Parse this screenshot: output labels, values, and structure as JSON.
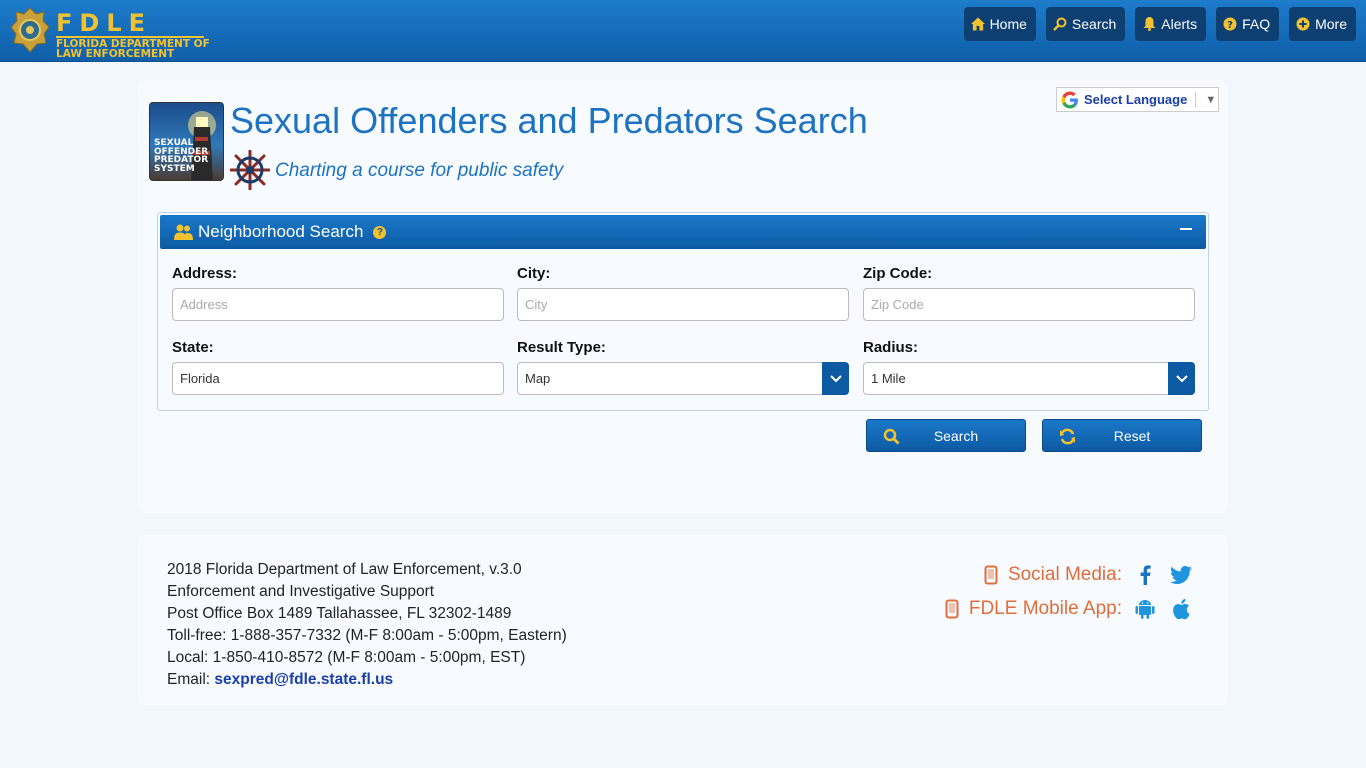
{
  "header": {
    "logo_title": "FDLE",
    "logo_subtitle_1": "FLORIDA DEPARTMENT OF",
    "logo_subtitle_2": "LAW ENFORCEMENT",
    "nav": [
      {
        "label": "Home",
        "icon": "home-icon"
      },
      {
        "label": "Search",
        "icon": "search-icon"
      },
      {
        "label": "Alerts",
        "icon": "bell-icon"
      },
      {
        "label": "FAQ",
        "icon": "question-icon"
      },
      {
        "label": "More",
        "icon": "plus-icon"
      }
    ]
  },
  "page": {
    "logo_text": [
      "SEXUAL",
      "OFFENDER",
      "PREDATOR",
      "SYSTEM"
    ],
    "title": "Sexual Offenders and Predators Search",
    "tagline": "Charting a course for public safety",
    "language_label": "Select Language"
  },
  "search": {
    "title": "Neighborhood Search",
    "fields": {
      "address": {
        "label": "Address:",
        "placeholder": "Address"
      },
      "city": {
        "label": "City:",
        "placeholder": "City"
      },
      "zip": {
        "label": "Zip Code:",
        "placeholder": "Zip Code"
      },
      "state": {
        "label": "State:",
        "value": "Florida"
      },
      "result_type": {
        "label": "Result Type:",
        "value": "Map"
      },
      "radius": {
        "label": "Radius:",
        "value": "1 Mile"
      }
    },
    "search_button": "Search",
    "reset_button": "Reset"
  },
  "footer": {
    "lines": [
      "2018 Florida Department of Law Enforcement, v.3.0",
      "Enforcement and Investigative Support",
      "Post Office Box 1489 Tallahassee, FL 32302-1489",
      "Toll-free: 1-888-357-7332 (M-F 8:00am - 5:00pm, Eastern)",
      "Local: 1-850-410-8572 (M-F 8:00am - 5:00pm, EST)"
    ],
    "email_label": "Email:",
    "email": "sexpred@fdle.state.fl.us",
    "social_label": "Social Media:",
    "app_label": "FDLE Mobile App:"
  },
  "colors": {
    "header_blue": "#1067b5",
    "title_blue": "#1e72c2",
    "accent_gold": "#f2c230",
    "footer_orange": "#e06d3c"
  }
}
